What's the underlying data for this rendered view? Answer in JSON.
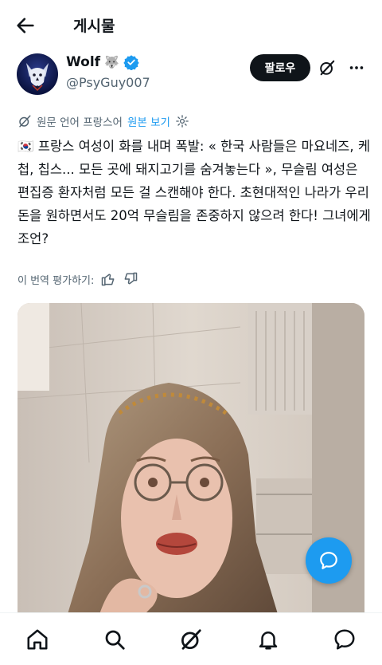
{
  "header": {
    "title": "게시물"
  },
  "author": {
    "name": "Wolf",
    "name_emoji": "🐺",
    "handle": "@PsyGuy007",
    "follow_label": "팔로우"
  },
  "translation": {
    "note": "원문 언어 프랑스어",
    "show_original": "원본 보기"
  },
  "post": {
    "flag": "🇰🇷",
    "text": " 프랑스 여성이 화를 내며 폭발: « 한국 사람들은 마요네즈, 케첩, 칩스... 모든 곳에 돼지고기를 숨겨놓는다 », 무슬림 여성은 편집증 환자처럼 모든 걸 스캔해야 한다. 초현대적인 나라가 우리 돈을 원하면서도 20억 무슬림을 존중하지 않으려 한다! 그녀에게 조언?"
  },
  "rating": {
    "label": "이 번역 평가하기:"
  },
  "icons": {
    "back": "back-arrow-icon",
    "verified": "verified-badge-icon",
    "grok": "grok-icon",
    "more": "more-icon",
    "settings": "gear-icon",
    "thumbs_up": "thumbs-up-icon",
    "thumbs_down": "thumbs-down-icon",
    "compose": "compose-message-icon",
    "home": "home-icon",
    "search": "search-icon",
    "notifications": "bell-icon",
    "messages": "message-icon"
  },
  "colors": {
    "accent": "#1d9bf0",
    "text": "#0f1419",
    "muted": "#536471"
  }
}
